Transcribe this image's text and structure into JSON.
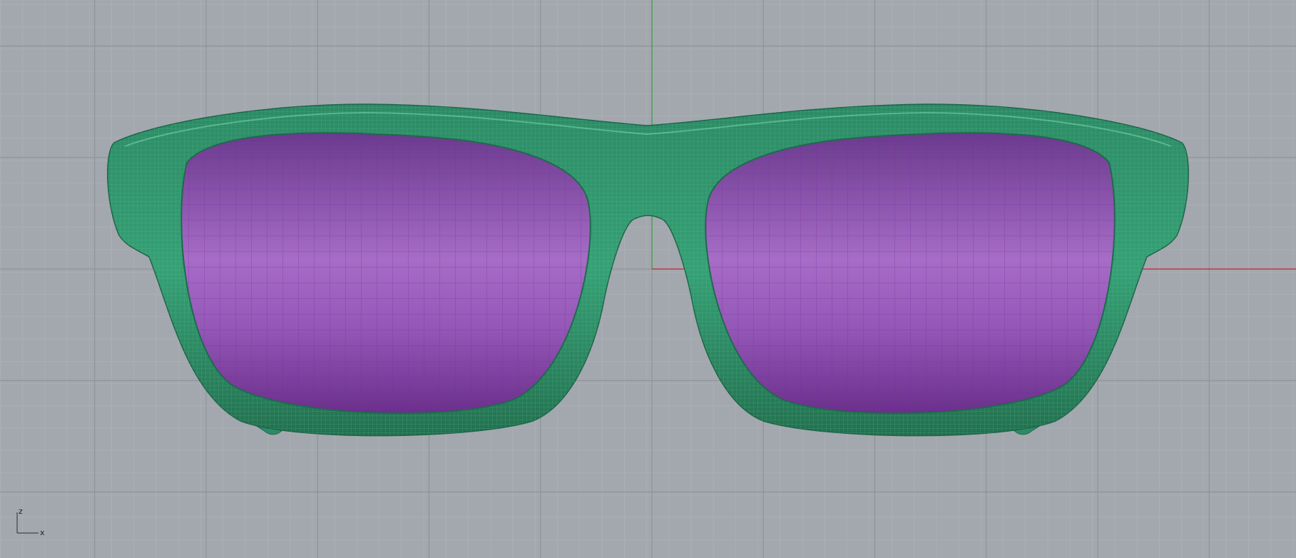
{
  "viewport": {
    "background_color": "#a3a8ae",
    "grid_minor_color": "#b0b5ba",
    "grid_major_color": "#8a8f94",
    "x_axis_color": "#c0262b",
    "z_axis_color": "#2aa33b"
  },
  "model": {
    "frame_color": "#2f8f6a",
    "frame_mesh_color": "#6cd3a8",
    "lens_color": "#7e4ea0",
    "lens_mesh_color": "#7d2aa6"
  },
  "axis_widget": {
    "vertical_label": "z",
    "horizontal_label": "x"
  }
}
